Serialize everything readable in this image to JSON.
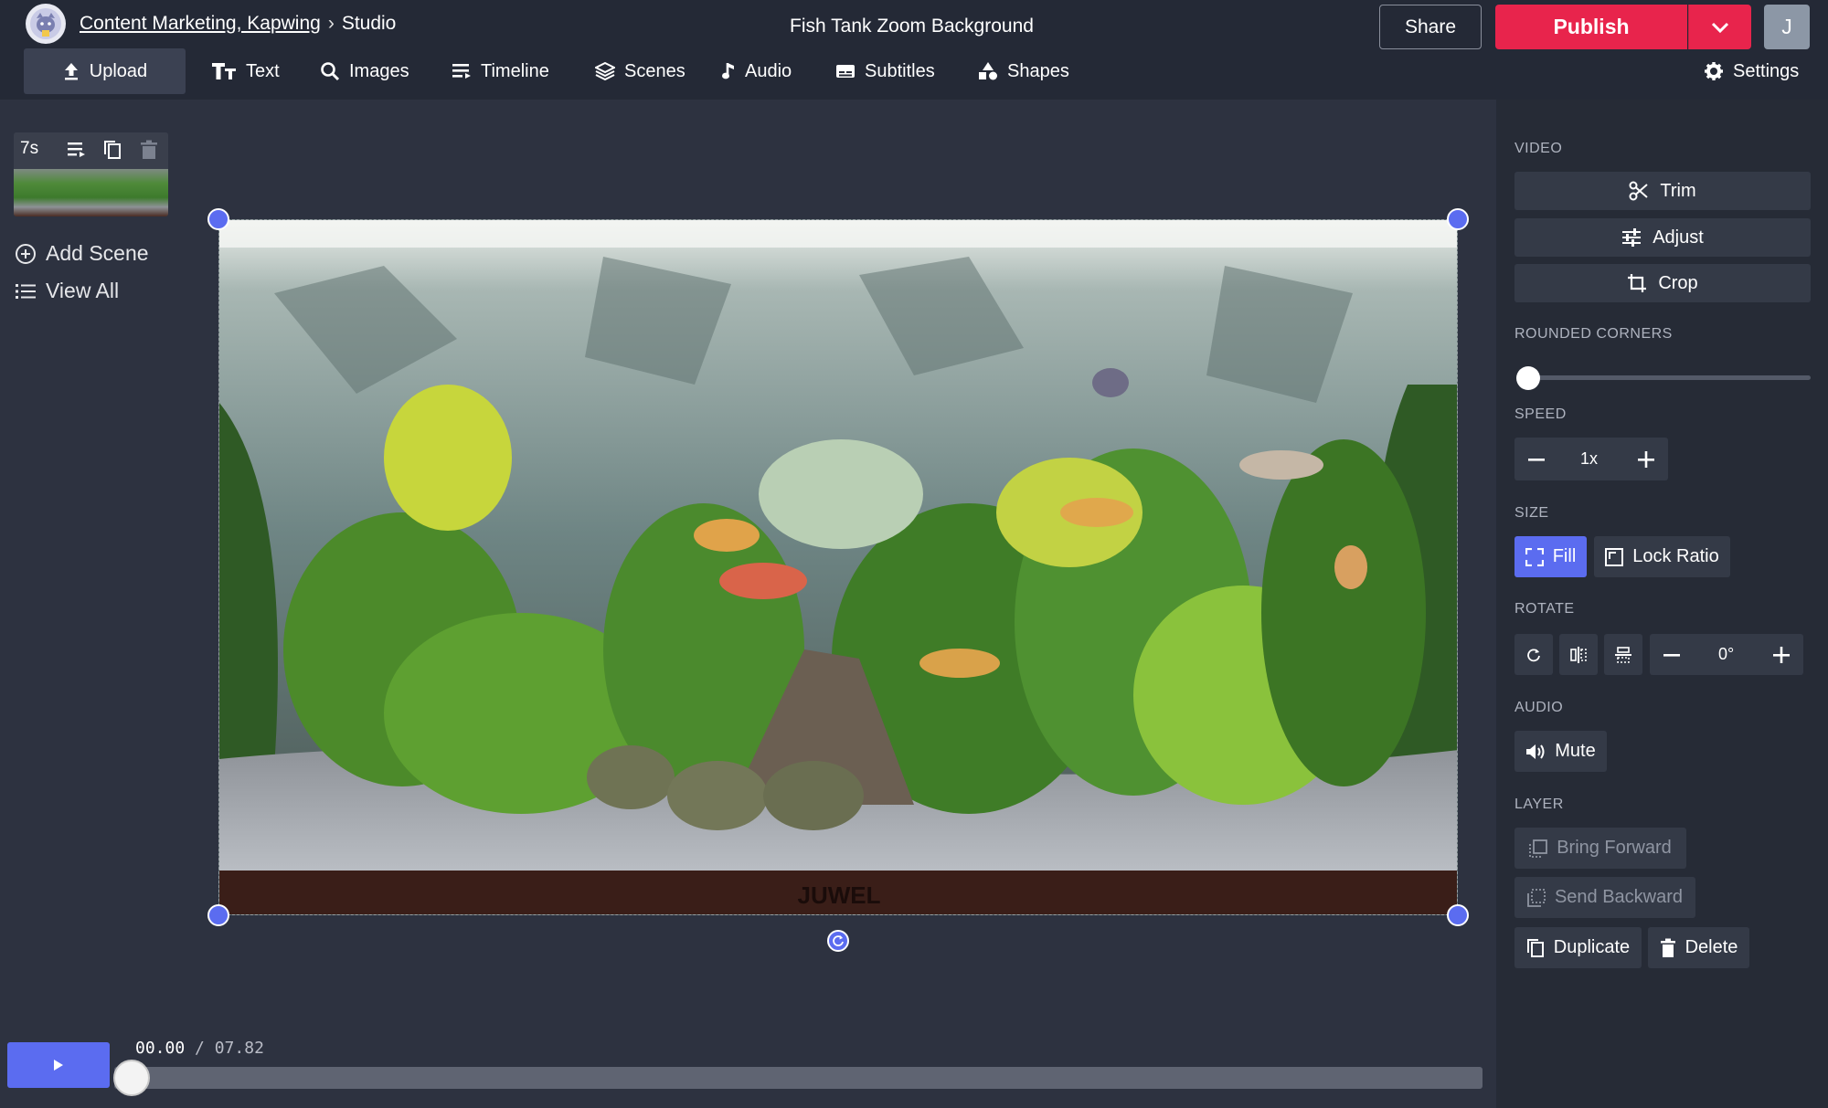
{
  "header": {
    "breadcrumb_link": "Content Marketing, Kapwing",
    "breadcrumb_separator": "›",
    "breadcrumb_current": "Studio",
    "project_title": "Fish Tank Zoom Background",
    "share_label": "Share",
    "publish_label": "Publish",
    "avatar_initial": "J"
  },
  "toolbar": {
    "upload": "Upload",
    "text": "Text",
    "images": "Images",
    "timeline": "Timeline",
    "scenes": "Scenes",
    "audio": "Audio",
    "subtitles": "Subtitles",
    "shapes": "Shapes",
    "settings": "Settings"
  },
  "scenes_panel": {
    "scene_duration": "7s",
    "add_scene": "Add Scene",
    "view_all": "View All"
  },
  "canvas": {
    "brand_text": "JUWEL"
  },
  "playback": {
    "current_time": "00.00",
    "separator": "/",
    "total_time": "07.82",
    "progress_fraction": 0.0
  },
  "right_panel": {
    "video_label": "VIDEO",
    "trim": "Trim",
    "adjust": "Adjust",
    "crop": "Crop",
    "rounded_corners_label": "ROUNDED CORNERS",
    "rounded_corners_value": 0,
    "speed_label": "SPEED",
    "speed_value": "1x",
    "size_label": "SIZE",
    "fill": "Fill",
    "lock_ratio": "Lock Ratio",
    "rotate_label": "ROTATE",
    "rotate_value": "0°",
    "audio_label": "AUDIO",
    "mute": "Mute",
    "layer_label": "LAYER",
    "bring_forward": "Bring Forward",
    "send_backward": "Send Backward",
    "duplicate": "Duplicate",
    "delete": "Delete"
  },
  "colors": {
    "accent": "#5b6cf0",
    "publish": "#e8244c",
    "background": "#2d3240",
    "header": "#242936"
  }
}
